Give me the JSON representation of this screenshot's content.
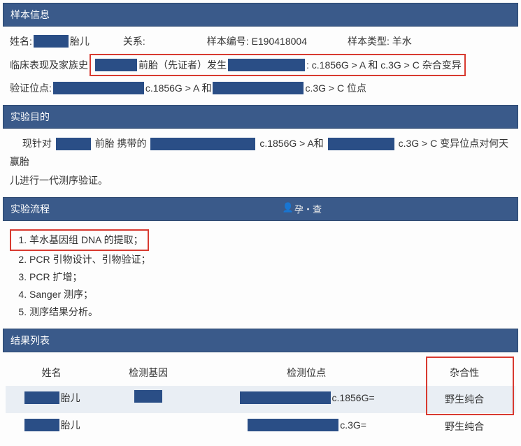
{
  "sample_info": {
    "header": "样本信息",
    "name_label": "姓名:",
    "name_suffix": "胎儿",
    "relation_label": "关系:",
    "sample_no_label": "样本编号:",
    "sample_no_value": "E190418004",
    "sample_type_label": "样本类型:",
    "sample_type_value": "羊水",
    "clinical_label": "临床表现及家族史",
    "clinical_pretext": "前胎（先证者）发生",
    "clinical_mid": ": c.1856G > A 和 c.3G > C 杂合变异",
    "verify_label": "验证位点:",
    "verify_mid1": "c.1856G > A 和",
    "verify_mid2": "c.3G > C 位点"
  },
  "purpose": {
    "header": "实验目的",
    "line_pre": "现针对",
    "line_mid1": "前胎 携带的",
    "line_mid2": "c.1856G > A和",
    "line_mid3": "c.3G > C 变异位点对何天赢胎",
    "line_tail": "儿进行一代测序验证。"
  },
  "procedure": {
    "header": "实验流程",
    "items": [
      "羊水基因组 DNA 的提取；",
      "PCR 引物设计、引物验证；",
      "PCR 扩增；",
      "Sanger 测序；",
      "测序结果分析。"
    ]
  },
  "results": {
    "header": "结果列表",
    "columns": {
      "name": "姓名",
      "gene": "检测基因",
      "site": "检测位点",
      "zygosity": "杂合性"
    },
    "rows": [
      {
        "name_suffix": "胎儿",
        "site_suffix": "c.1856G=",
        "zygosity": "野生纯合"
      },
      {
        "name_suffix": "胎儿",
        "site_suffix": "c.3G=",
        "zygosity": "野生纯合"
      }
    ]
  },
  "watermark": "孕・查"
}
